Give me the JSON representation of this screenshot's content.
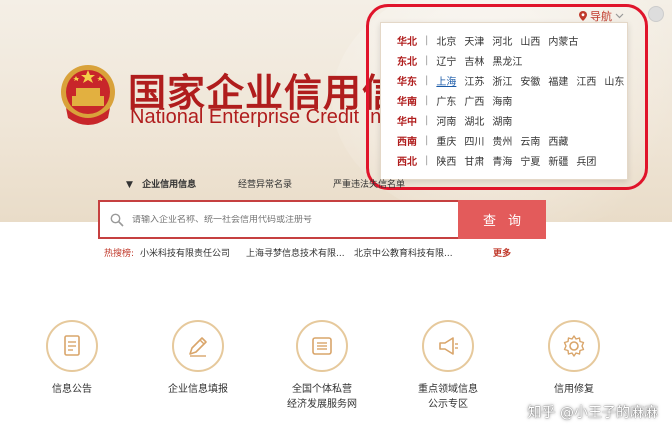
{
  "header": {
    "title_cn": "国家企业信用信",
    "title_en": "National Enterprise Credit Info",
    "nav_label": "导航"
  },
  "regions": [
    {
      "name": "华北",
      "cities": [
        "北京",
        "天津",
        "河北",
        "山西",
        "内蒙古"
      ]
    },
    {
      "name": "东北",
      "cities": [
        "辽宁",
        "吉林",
        "黑龙江"
      ]
    },
    {
      "name": "华东",
      "cities": [
        "上海",
        "江苏",
        "浙江",
        "安徽",
        "福建",
        "江西",
        "山东"
      ],
      "link_index": 0
    },
    {
      "name": "华南",
      "cities": [
        "广东",
        "广西",
        "海南"
      ]
    },
    {
      "name": "华中",
      "cities": [
        "河南",
        "湖北",
        "湖南"
      ]
    },
    {
      "name": "西南",
      "cities": [
        "重庆",
        "四川",
        "贵州",
        "云南",
        "西藏"
      ]
    },
    {
      "name": "西北",
      "cities": [
        "陕西",
        "甘肃",
        "青海",
        "宁夏",
        "新疆",
        "兵团"
      ]
    }
  ],
  "tabs": [
    {
      "label": "企业信用信息",
      "marker": "▼"
    },
    {
      "label": "经营异常名录"
    },
    {
      "label": "严重违法失信名单"
    }
  ],
  "search": {
    "placeholder": "请输入企业名称、统一社会信用代码或注册号",
    "button_label": "查询"
  },
  "hot_search": {
    "label": "热搜榜:",
    "items": [
      "小米科技有限责任公司",
      "上海寻梦信息技术有限...",
      "北京中公教育科技有限..."
    ],
    "more": "更多"
  },
  "services": [
    {
      "label": "信息公告",
      "icon": "document-icon"
    },
    {
      "label": "企业信息填报",
      "icon": "pen-icon"
    },
    {
      "label": "全国个体私营经济发展服务网",
      "line1": "全国个体私营",
      "line2": "经济发展服务网",
      "icon": "list-icon"
    },
    {
      "label": "重点领域信息公示专区",
      "line1": "重点领域信息",
      "line2": "公示专区",
      "icon": "megaphone-icon"
    },
    {
      "label": "信用修复",
      "icon": "gear-icon"
    }
  ],
  "watermark": "知乎 @小王子的麻麻",
  "colors": {
    "brand_red": "#b01d1d",
    "search_button": "#e35b5b",
    "annotation": "#e0142b",
    "icon_ring": "#e6c99c"
  }
}
